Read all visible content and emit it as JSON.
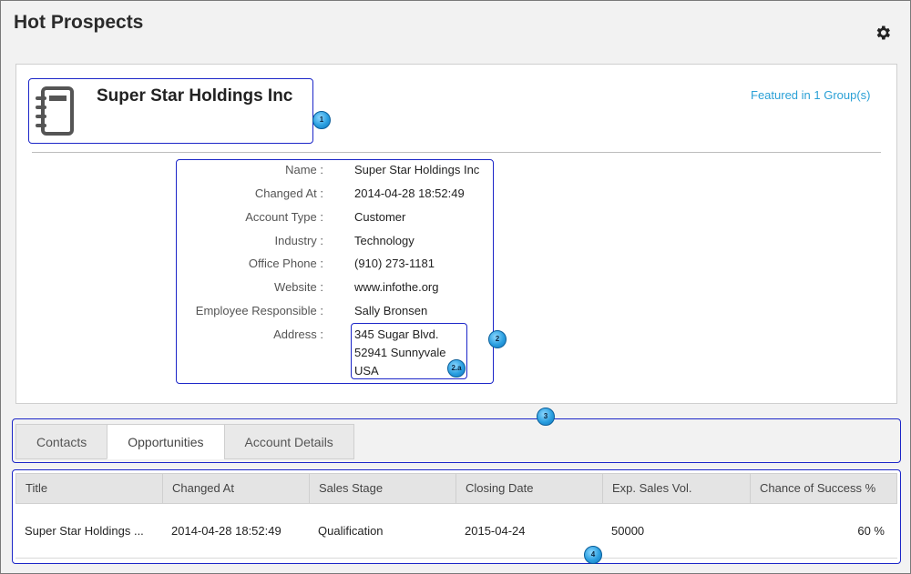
{
  "page": {
    "title": "Hot Prospects"
  },
  "account": {
    "name": "Super Star Holdings Inc",
    "featured_link": "Featured in 1 Group(s)"
  },
  "fields": [
    {
      "label": "Name :",
      "value": "Super Star Holdings Inc"
    },
    {
      "label": "Changed At :",
      "value": "2014-04-28 18:52:49"
    },
    {
      "label": "Account Type :",
      "value": "Customer"
    },
    {
      "label": "Industry :",
      "value": "Technology"
    },
    {
      "label": "Office Phone :",
      "value": "(910) 273-1181"
    },
    {
      "label": "Website :",
      "value": "www.infothe.org"
    },
    {
      "label": "Employee Responsible :",
      "value": "Sally Bronsen"
    },
    {
      "label": "Address :",
      "value": ""
    }
  ],
  "address": {
    "line1": "345 Sugar Blvd.",
    "line2": "52941 Sunnyvale",
    "line3": "USA"
  },
  "callouts": {
    "c1": "1",
    "c2": "2",
    "c2a": "2.a",
    "c3": "3",
    "c4": "4"
  },
  "tabs": [
    {
      "label": "Contacts"
    },
    {
      "label": "Opportunities"
    },
    {
      "label": "Account Details"
    }
  ],
  "table": {
    "columns": [
      "Title",
      "Changed At",
      "Sales Stage",
      "Closing Date",
      "Exp. Sales Vol.",
      "Chance of Success %"
    ],
    "rows": [
      [
        "Super Star Holdings ...",
        "2014-04-28 18:52:49",
        "Qualification",
        "2015-04-24",
        "50000",
        "60 %"
      ]
    ]
  },
  "icons": {
    "settings": "gear-icon",
    "account": "address-book-icon"
  },
  "colors": {
    "link": "#2aa0d6",
    "highlight": "#1c26c8",
    "badge": "#2a9fe0"
  }
}
